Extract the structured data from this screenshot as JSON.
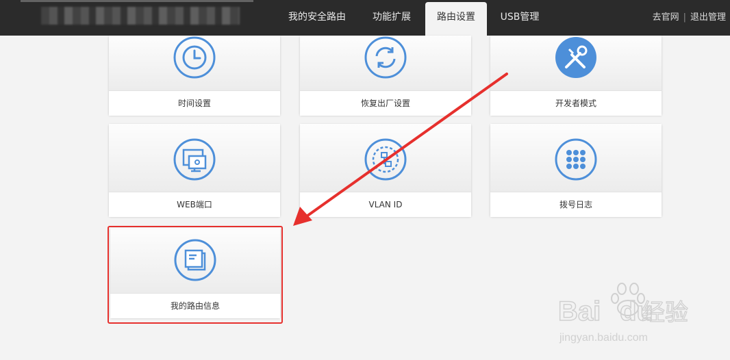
{
  "nav": {
    "tabs": [
      "我的安全路由",
      "功能扩展",
      "路由设置",
      "USB管理"
    ],
    "active": "路由设置",
    "links": [
      "去官网",
      "退出管理"
    ],
    "separator": "|"
  },
  "tiles": [
    {
      "label": "时间设置",
      "icon": "clock-icon"
    },
    {
      "label": "恢复出厂设置",
      "icon": "restore-icon"
    },
    {
      "label": "开发者模式",
      "icon": "tools-icon"
    },
    {
      "label": "WEB端口",
      "icon": "web-port-icon"
    },
    {
      "label": "VLAN ID",
      "icon": "vlan-icon"
    },
    {
      "label": "拨号日志",
      "icon": "dial-log-icon"
    },
    {
      "label": "我的路由信息",
      "icon": "router-info-icon"
    }
  ],
  "colors": {
    "accent": "#4d8fd9",
    "highlight": "#e6302d",
    "topbar": "#2b2b2b"
  },
  "watermark": {
    "brand": "Bai",
    "brand2": "du",
    "suffix": "经验",
    "url": "jingyan.baidu.com"
  }
}
